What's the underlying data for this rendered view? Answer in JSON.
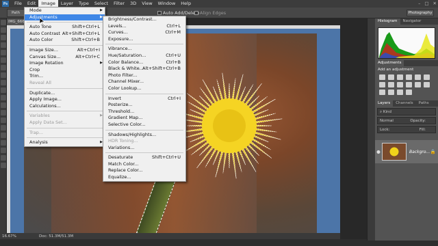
{
  "menubar": {
    "logo": "Ps",
    "items": [
      "File",
      "Edit",
      "Image",
      "Layer",
      "Type",
      "Select",
      "Filter",
      "3D",
      "View",
      "Window",
      "Help"
    ],
    "active_index": 2
  },
  "options": {
    "tool_label": "Path",
    "auto_add_delete": "Auto Add/Delete",
    "align_edges": "Align Edges",
    "workspace": "Photography"
  },
  "doc": {
    "tab_title": "IMG_666"
  },
  "status": {
    "zoom": "16.67%",
    "doc_info": "Doc: 51.3M/51.3M"
  },
  "right_panel": {
    "tabs_top": [
      "Histogram",
      "Navigator"
    ],
    "adjustments_tab": "Adjustments",
    "add_adjustment": "Add an adjustment",
    "layers_tabs": [
      "Layers",
      "Channels",
      "Paths"
    ],
    "kind_label": "Kind",
    "blend_mode": "Normal",
    "opacity_label": "Opacity:",
    "lock_label": "Lock:",
    "fill_label": "Fill:",
    "layer_name": "Backgro..."
  },
  "image_menu": [
    {
      "label": "Mode",
      "arrow": true
    },
    {
      "label": "Adjustments",
      "arrow": true,
      "hl": true
    },
    {
      "sep": true
    },
    {
      "label": "Auto Tone",
      "sc": "Shift+Ctrl+L"
    },
    {
      "label": "Auto Contrast",
      "sc": "Alt+Shift+Ctrl+L"
    },
    {
      "label": "Auto Color",
      "sc": "Shift+Ctrl+B"
    },
    {
      "sep": true
    },
    {
      "label": "Image Size...",
      "sc": "Alt+Ctrl+I"
    },
    {
      "label": "Canvas Size...",
      "sc": "Alt+Ctrl+C"
    },
    {
      "label": "Image Rotation",
      "arrow": true
    },
    {
      "label": "Crop"
    },
    {
      "label": "Trim..."
    },
    {
      "label": "Reveal All",
      "disabled": true
    },
    {
      "sep": true
    },
    {
      "label": "Duplicate..."
    },
    {
      "label": "Apply Image..."
    },
    {
      "label": "Calculations..."
    },
    {
      "sep": true
    },
    {
      "label": "Variables",
      "arrow": true,
      "disabled": true
    },
    {
      "label": "Apply Data Set...",
      "disabled": true
    },
    {
      "sep": true
    },
    {
      "label": "Trap...",
      "disabled": true
    },
    {
      "sep": true
    },
    {
      "label": "Analysis",
      "arrow": true
    }
  ],
  "adjustments_menu": [
    {
      "label": "Brightness/Contrast..."
    },
    {
      "label": "Levels...",
      "sc": "Ctrl+L"
    },
    {
      "label": "Curves...",
      "sc": "Ctrl+M"
    },
    {
      "label": "Exposure..."
    },
    {
      "sep": true
    },
    {
      "label": "Vibrance..."
    },
    {
      "label": "Hue/Saturation...",
      "sc": "Ctrl+U"
    },
    {
      "label": "Color Balance...",
      "sc": "Ctrl+B"
    },
    {
      "label": "Black & White...",
      "sc": "Alt+Shift+Ctrl+B"
    },
    {
      "label": "Photo Filter..."
    },
    {
      "label": "Channel Mixer..."
    },
    {
      "label": "Color Lookup..."
    },
    {
      "sep": true
    },
    {
      "label": "Invert",
      "sc": "Ctrl+I"
    },
    {
      "label": "Posterize..."
    },
    {
      "label": "Threshold..."
    },
    {
      "label": "Gradient Map..."
    },
    {
      "label": "Selective Color..."
    },
    {
      "sep": true
    },
    {
      "label": "Shadows/Highlights..."
    },
    {
      "label": "HDR Toning...",
      "disabled": true
    },
    {
      "label": "Variations..."
    },
    {
      "sep": true
    },
    {
      "label": "Desaturate",
      "sc": "Shift+Ctrl+U"
    },
    {
      "label": "Match Color..."
    },
    {
      "label": "Replace Color..."
    },
    {
      "label": "Equalize..."
    }
  ],
  "colors": {
    "menu_highlight": "#3f87e6",
    "canvas_bg": "#4c75a8",
    "flower": "#f2d11c"
  },
  "icons": {
    "eye": "eye-icon",
    "lock": "lock-icon",
    "cursor": "arrow-cursor-icon"
  }
}
